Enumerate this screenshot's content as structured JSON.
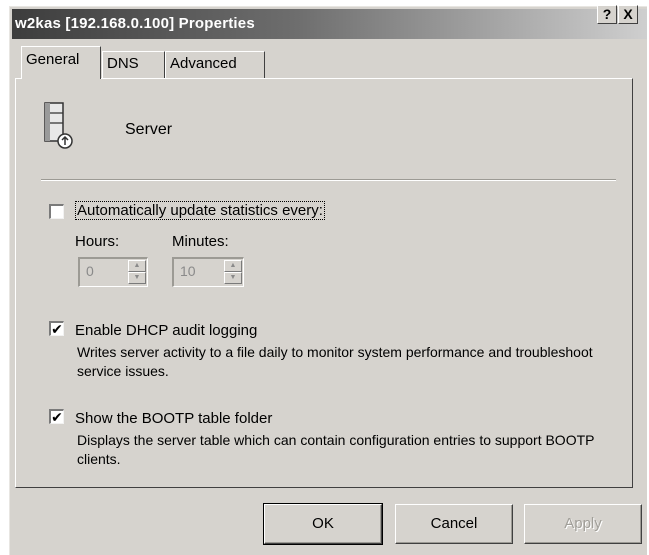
{
  "window": {
    "title": "w2kas [192.168.0.100] Properties",
    "help_glyph": "?",
    "close_glyph": "X"
  },
  "tabs": [
    {
      "label": "General",
      "active": true
    },
    {
      "label": "DNS",
      "active": false
    },
    {
      "label": "Advanced",
      "active": false
    }
  ],
  "general": {
    "server_label": "Server",
    "auto_update": {
      "label": "Automatically update statistics every:",
      "checked": false
    },
    "hours": {
      "label": "Hours:",
      "value": "0"
    },
    "minutes": {
      "label": "Minutes:",
      "value": "10"
    },
    "dhcp_audit": {
      "label": "Enable DHCP audit logging",
      "checked": true,
      "description": "Writes server activity to a file daily to monitor system performance and troubleshoot service issues."
    },
    "bootp": {
      "label": "Show the BOOTP table folder",
      "checked": true,
      "description": "Displays the server table which can contain configuration entries to support BOOTP clients."
    }
  },
  "buttons": {
    "ok": "OK",
    "cancel": "Cancel",
    "apply": "Apply"
  },
  "icons": {
    "server": "server-icon",
    "check_glyph": "✔"
  },
  "colors": {
    "dialog_bg": "#d6d3ce",
    "title_gradient_start": "#3d3d3d",
    "title_gradient_end": "#cfcfcf"
  }
}
